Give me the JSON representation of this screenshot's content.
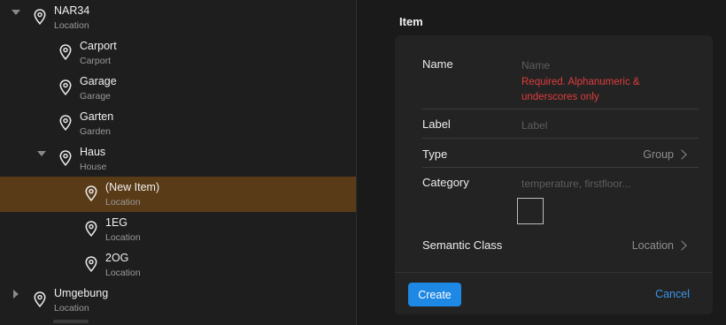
{
  "tree": {
    "items": [
      {
        "title": "NAR34",
        "subtitle": "Location"
      },
      {
        "title": "Carport",
        "subtitle": "Carport"
      },
      {
        "title": "Garage",
        "subtitle": "Garage"
      },
      {
        "title": "Garten",
        "subtitle": "Garden"
      },
      {
        "title": "Haus",
        "subtitle": "House"
      },
      {
        "title": "(New Item)",
        "subtitle": "Location"
      },
      {
        "title": "1EG",
        "subtitle": "Location"
      },
      {
        "title": "2OG",
        "subtitle": "Location"
      },
      {
        "title": "Umgebung",
        "subtitle": "Location"
      }
    ]
  },
  "form": {
    "title": "Item",
    "name_label": "Name",
    "name_placeholder": "Name",
    "name_error": "Required. Alphanumeric & underscores only",
    "label_label": "Label",
    "label_placeholder": "Label",
    "type_label": "Type",
    "type_value": "Group",
    "category_label": "Category",
    "category_placeholder": "temperature, firstfloor...",
    "semantic_label": "Semantic Class",
    "semantic_value": "Location",
    "create_label": "Create",
    "cancel_label": "Cancel"
  },
  "colors": {
    "accent": "#1e88e5",
    "selected_row": "#5a3b18",
    "error": "#e03c3c"
  }
}
